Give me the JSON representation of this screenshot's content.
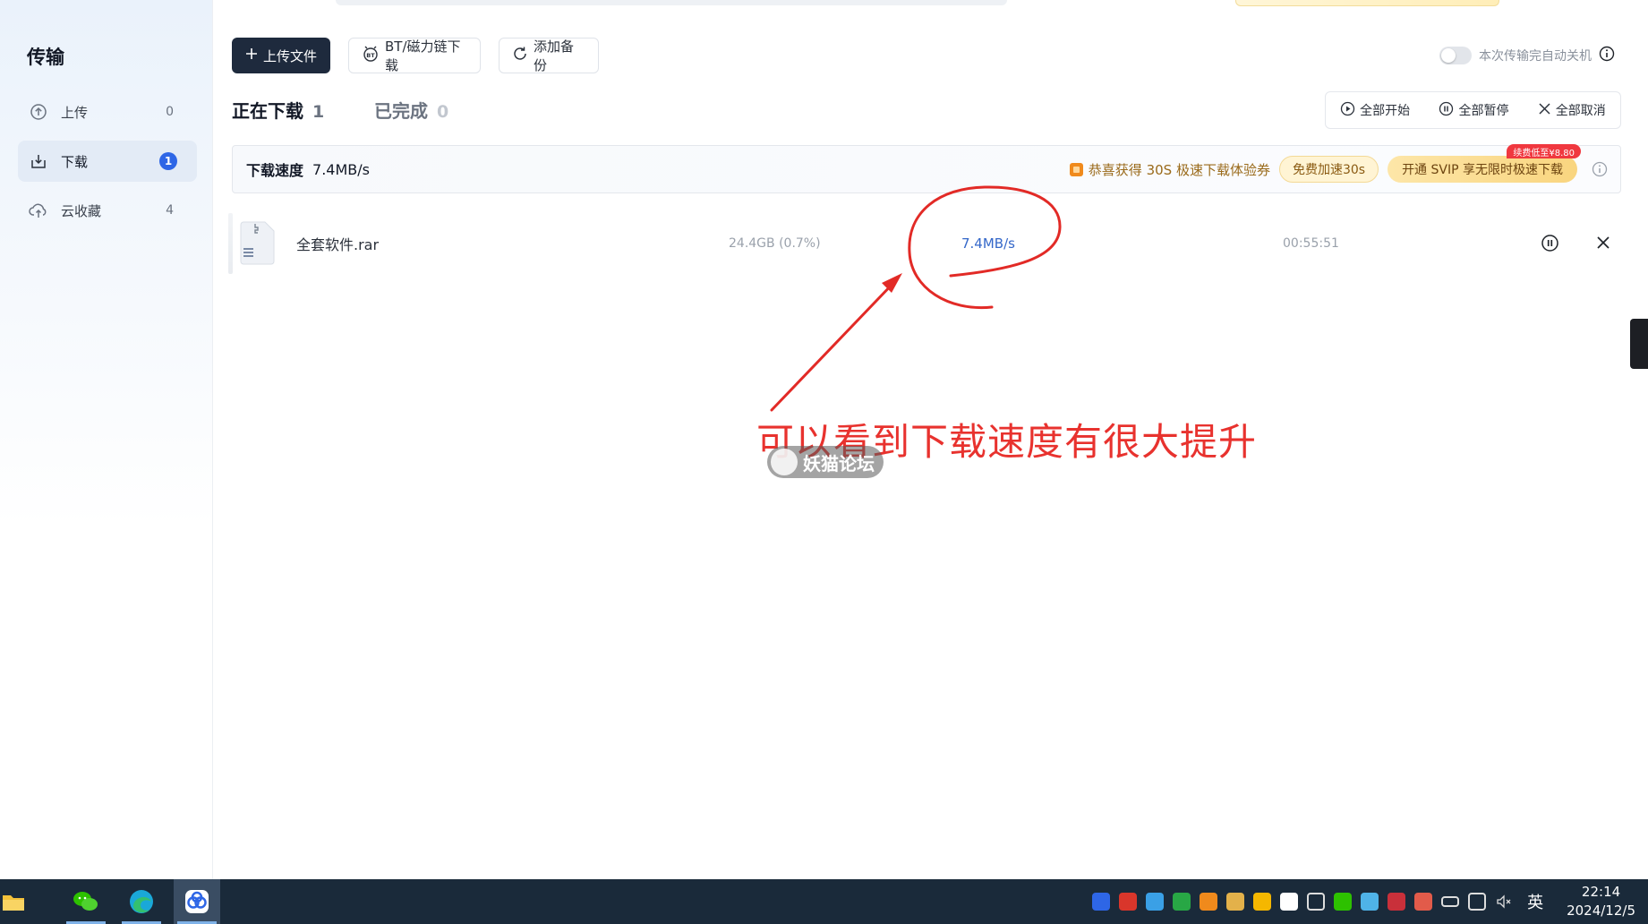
{
  "sidebar": {
    "title": "传输",
    "items": [
      {
        "label": "上传",
        "count": "0"
      },
      {
        "label": "下载",
        "count": "1"
      },
      {
        "label": "云收藏",
        "count": "4"
      }
    ]
  },
  "toolbar": {
    "upload_label": "上传文件",
    "bt_label": "BT/磁力链下载",
    "backup_label": "添加备份",
    "auto_shutdown_label": "本次传输完自动关机"
  },
  "tabs": {
    "downloading_label": "正在下载",
    "downloading_count": "1",
    "completed_label": "已完成",
    "completed_count": "0"
  },
  "bulk": {
    "start_all": "全部开始",
    "pause_all": "全部暂停",
    "cancel_all": "全部取消"
  },
  "speed_bar": {
    "label": "下载速度",
    "value": "7.4MB/s",
    "promo_text": "恭喜获得 30S 极速下载体验券",
    "free_button": "免费加速30s",
    "svip_button": "开通 SVIP 享无限时极速下载",
    "svip_tag": "续费低至¥8.80"
  },
  "downloads": [
    {
      "name": "全套软件.rar",
      "size": "24.4GB (0.7%)",
      "speed": "7.4MB/s",
      "time_left": "00:55:51"
    }
  ],
  "annotation": {
    "text": "可以看到下载速度有很大提升",
    "watermark": "妖猫论坛"
  },
  "taskbar": {
    "lang": "英",
    "time": "22:14",
    "date": "2024/12/5"
  },
  "colors": {
    "accent": "#2e66e6",
    "primary_button": "#1e2a3d",
    "annotation": "#e8322e",
    "speed_text": "#3568c9"
  }
}
